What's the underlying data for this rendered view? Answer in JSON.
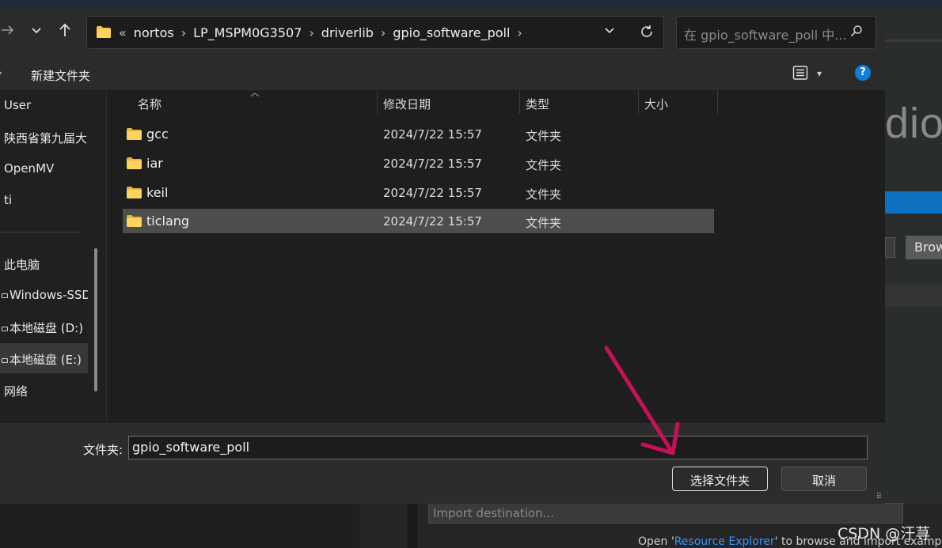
{
  "dialog": {
    "address": {
      "overflow": "«",
      "crumbs": [
        "nortos",
        "LP_MSPM0G3507",
        "driverlib",
        "gpio_software_poll"
      ],
      "separator": "›"
    },
    "search": {
      "placeholder": "在 gpio_software_poll 中..."
    },
    "toolbar": {
      "new_folder": "新建文件夹",
      "help": "?"
    },
    "sidebar": {
      "items": [
        {
          "label": "User"
        },
        {
          "label": "陕西省第九届大"
        },
        {
          "label": "OpenMV"
        },
        {
          "label": "ti"
        },
        {
          "label": "此电脑"
        },
        {
          "label": "Windows-SSD"
        },
        {
          "label": "本地磁盘 (D:)"
        },
        {
          "label": "本地磁盘 (E:)"
        },
        {
          "label": "网络"
        }
      ]
    },
    "columns": {
      "name": "名称",
      "modified": "修改日期",
      "type": "类型",
      "size": "大小"
    },
    "files": [
      {
        "name": "gcc",
        "modified": "2024/7/22 15:57",
        "type": "文件夹"
      },
      {
        "name": "iar",
        "modified": "2024/7/22 15:57",
        "type": "文件夹"
      },
      {
        "name": "keil",
        "modified": "2024/7/22 15:57",
        "type": "文件夹"
      },
      {
        "name": "ticlang",
        "modified": "2024/7/22 15:57",
        "type": "文件夹"
      }
    ],
    "footer": {
      "folder_label": "文件夹:",
      "folder_value": "gpio_software_poll",
      "select_button": "选择文件夹",
      "cancel_button": "取消"
    }
  },
  "background": {
    "title_fragment": "dio",
    "browse": "Brow",
    "import_placeholder": "Import destination...",
    "open_prefix": "Open '",
    "open_link": "Resource Explorer",
    "open_suffix": "' to browse and import example p"
  },
  "watermark": "CSDN @汗荨",
  "colors": {
    "accent": "#0e70c0",
    "annotation": "#c8105a",
    "selection": "#4d4d4d"
  }
}
